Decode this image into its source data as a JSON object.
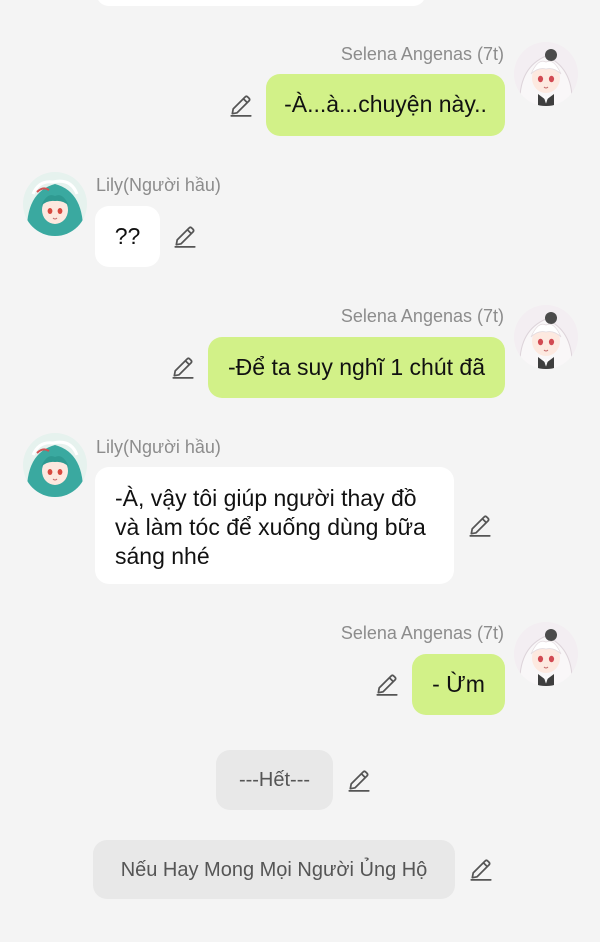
{
  "messages": [
    {
      "sender": "Selena Angenas (7t)",
      "text": "-À...à...chuyện này..",
      "side": "right"
    },
    {
      "sender": "Lily(Người hầu)",
      "text": "??",
      "side": "left"
    },
    {
      "sender": "Selena Angenas (7t)",
      "text": "-Để ta suy nghĩ 1 chút đã",
      "side": "right"
    },
    {
      "sender": "Lily(Người hầu)",
      "text": "-À, vậy tôi giúp người thay đồ và làm tóc để xuống dùng bữa sáng nhé",
      "side": "left"
    },
    {
      "sender": "Selena Angenas (7t)",
      "text": "- Ừm",
      "side": "right"
    }
  ],
  "notes": [
    {
      "text": "---Hết---"
    },
    {
      "text": "Nếu Hay Mong Mọi Người Ủng Hộ"
    }
  ],
  "icons": {
    "edit": "pencil-icon",
    "avatar_selena": "avatar-selena",
    "avatar_lily": "avatar-lily"
  },
  "colors": {
    "background": "#f4f4f4",
    "self_bubble": "#d2f188",
    "other_bubble": "#ffffff",
    "note_bubble": "#e8e8e8",
    "sender_name": "#8c8c8c"
  }
}
